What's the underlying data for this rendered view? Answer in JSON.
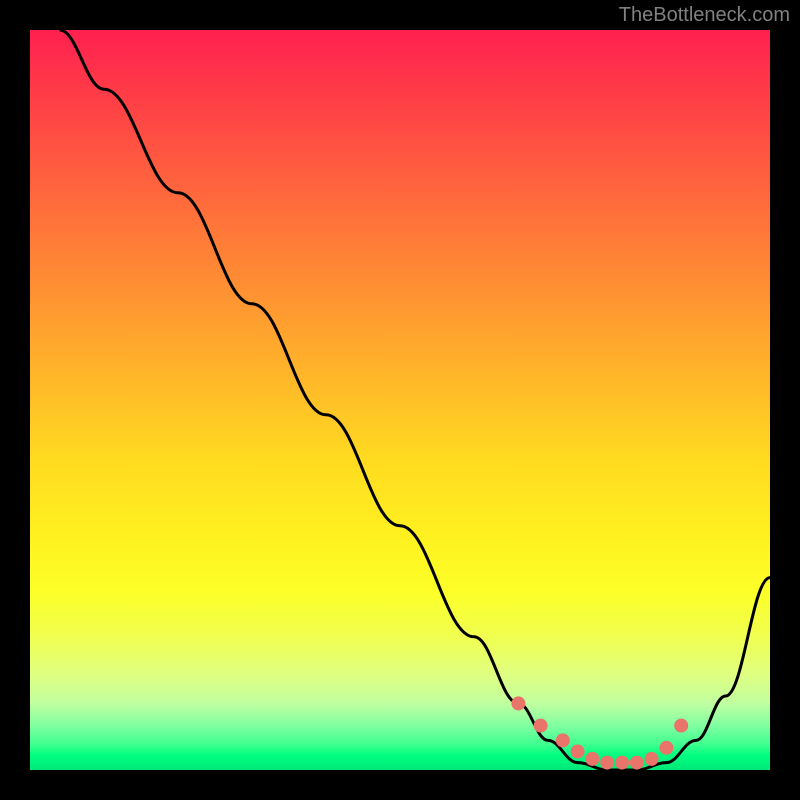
{
  "watermark": "TheBottleneck.com",
  "chart_data": {
    "type": "line",
    "title": "",
    "xlabel": "",
    "ylabel": "",
    "xlim": [
      0,
      100
    ],
    "ylim": [
      0,
      100
    ],
    "grid": false,
    "legend": false,
    "series": [
      {
        "name": "bottleneck-curve",
        "color": "#000000",
        "x": [
          4,
          10,
          20,
          30,
          40,
          50,
          60,
          66,
          70,
          74,
          78,
          82,
          86,
          90,
          94,
          100
        ],
        "y": [
          100,
          92,
          78,
          63,
          48,
          33,
          18,
          9,
          4,
          1,
          0,
          0,
          1,
          4,
          10,
          26
        ]
      },
      {
        "name": "optimal-zone-markers",
        "type": "scatter",
        "color": "#e8746a",
        "x": [
          66,
          69,
          72,
          74,
          76,
          78,
          80,
          82,
          84,
          86,
          88
        ],
        "y": [
          9,
          6,
          4,
          2.5,
          1.5,
          1,
          1,
          1,
          1.5,
          3,
          6
        ]
      }
    ],
    "background_gradient": {
      "top": "#ff2050",
      "mid": "#fff020",
      "bottom": "#00e878"
    },
    "annotations": []
  }
}
